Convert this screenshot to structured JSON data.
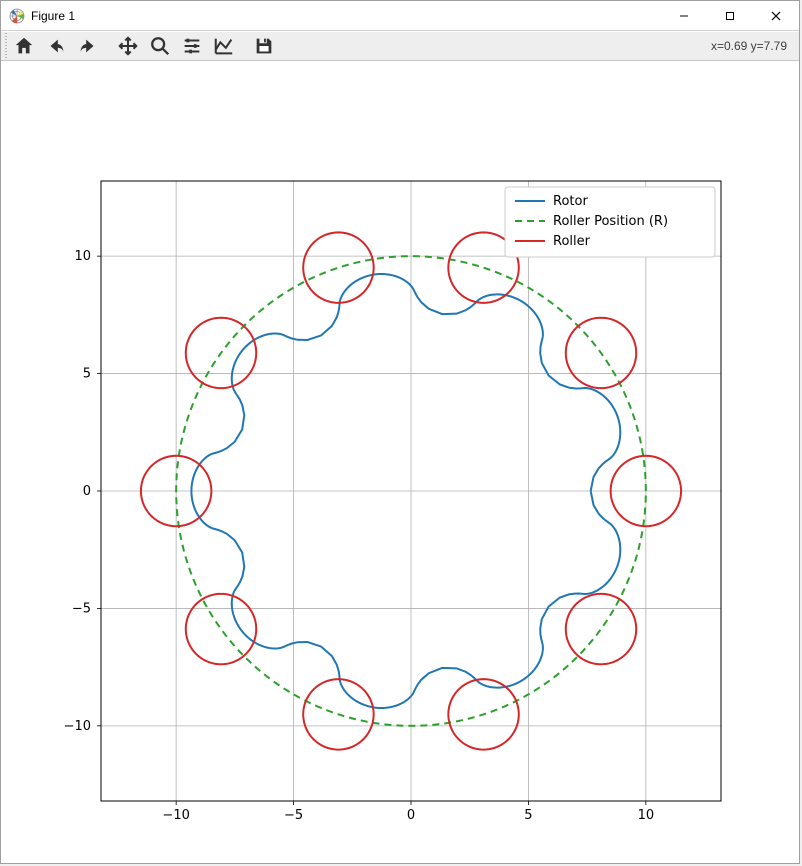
{
  "window": {
    "title": "Figure 1"
  },
  "toolbar": {
    "coords_label": "x=0.69 y=7.79"
  },
  "chart_data": {
    "type": "line",
    "title": "",
    "xlabel": "",
    "ylabel": "",
    "xlim": [
      -13.2,
      13.2
    ],
    "ylim": [
      -13.2,
      13.2
    ],
    "grid": true,
    "xticks": [
      -10,
      -5,
      0,
      5,
      10
    ],
    "yticks": [
      -10,
      -5,
      0,
      5,
      10
    ],
    "legend": {
      "position": "upper right",
      "entries": [
        "Rotor",
        "Roller Position (R)",
        "Roller"
      ]
    },
    "parameters": {
      "R": 10.0,
      "E": 0.85,
      "Rr": 1.5,
      "N_pins": 10
    },
    "series": [
      {
        "name": "Rotor",
        "type": "line",
        "color": "#1f77b4",
        "linestyle": "solid",
        "description": "cycloidal rotor profile: parametric curve x(t)=R cos t - Rr cos(t+atan2(sin((1-N)t), R/(E N)-cos((1-N)t))) - E cos(N t); y(t)=-R sin t + Rr sin(t+atan2(...)) + E sin(N t); t in [0, 2pi]; R=10 E=0.85 Rr=1.5 N=10"
      },
      {
        "name": "Roller Position (R)",
        "type": "line",
        "color": "#2ca02c",
        "linestyle": "dashed",
        "description": "reference circle radius R=10 centered at origin"
      },
      {
        "name": "Roller",
        "type": "circles",
        "color": "#d62728",
        "linestyle": "solid",
        "radius": 1.5,
        "centers_description": "10 circles of radius Rr=1.5 centered at (R cos(2πk/10), R sin(2πk/10)) for k=0..9",
        "centers": [
          [
            10.0,
            0.0
          ],
          [
            8.09,
            5.878
          ],
          [
            3.09,
            9.511
          ],
          [
            -3.09,
            9.511
          ],
          [
            -8.09,
            5.878
          ],
          [
            -10.0,
            0.0
          ],
          [
            -8.09,
            -5.878
          ],
          [
            -3.09,
            -9.511
          ],
          [
            3.09,
            -9.511
          ],
          [
            8.09,
            -5.878
          ]
        ]
      }
    ],
    "tick_labels": {
      "x": {
        "_n10": "−10",
        "_n5": "−5",
        "_0": "0",
        "_5": "5",
        "_10": "10"
      },
      "y": {
        "_n10": "−10",
        "_n5": "−5",
        "_0": "0",
        "_5": "5",
        "_10": "10"
      }
    }
  }
}
